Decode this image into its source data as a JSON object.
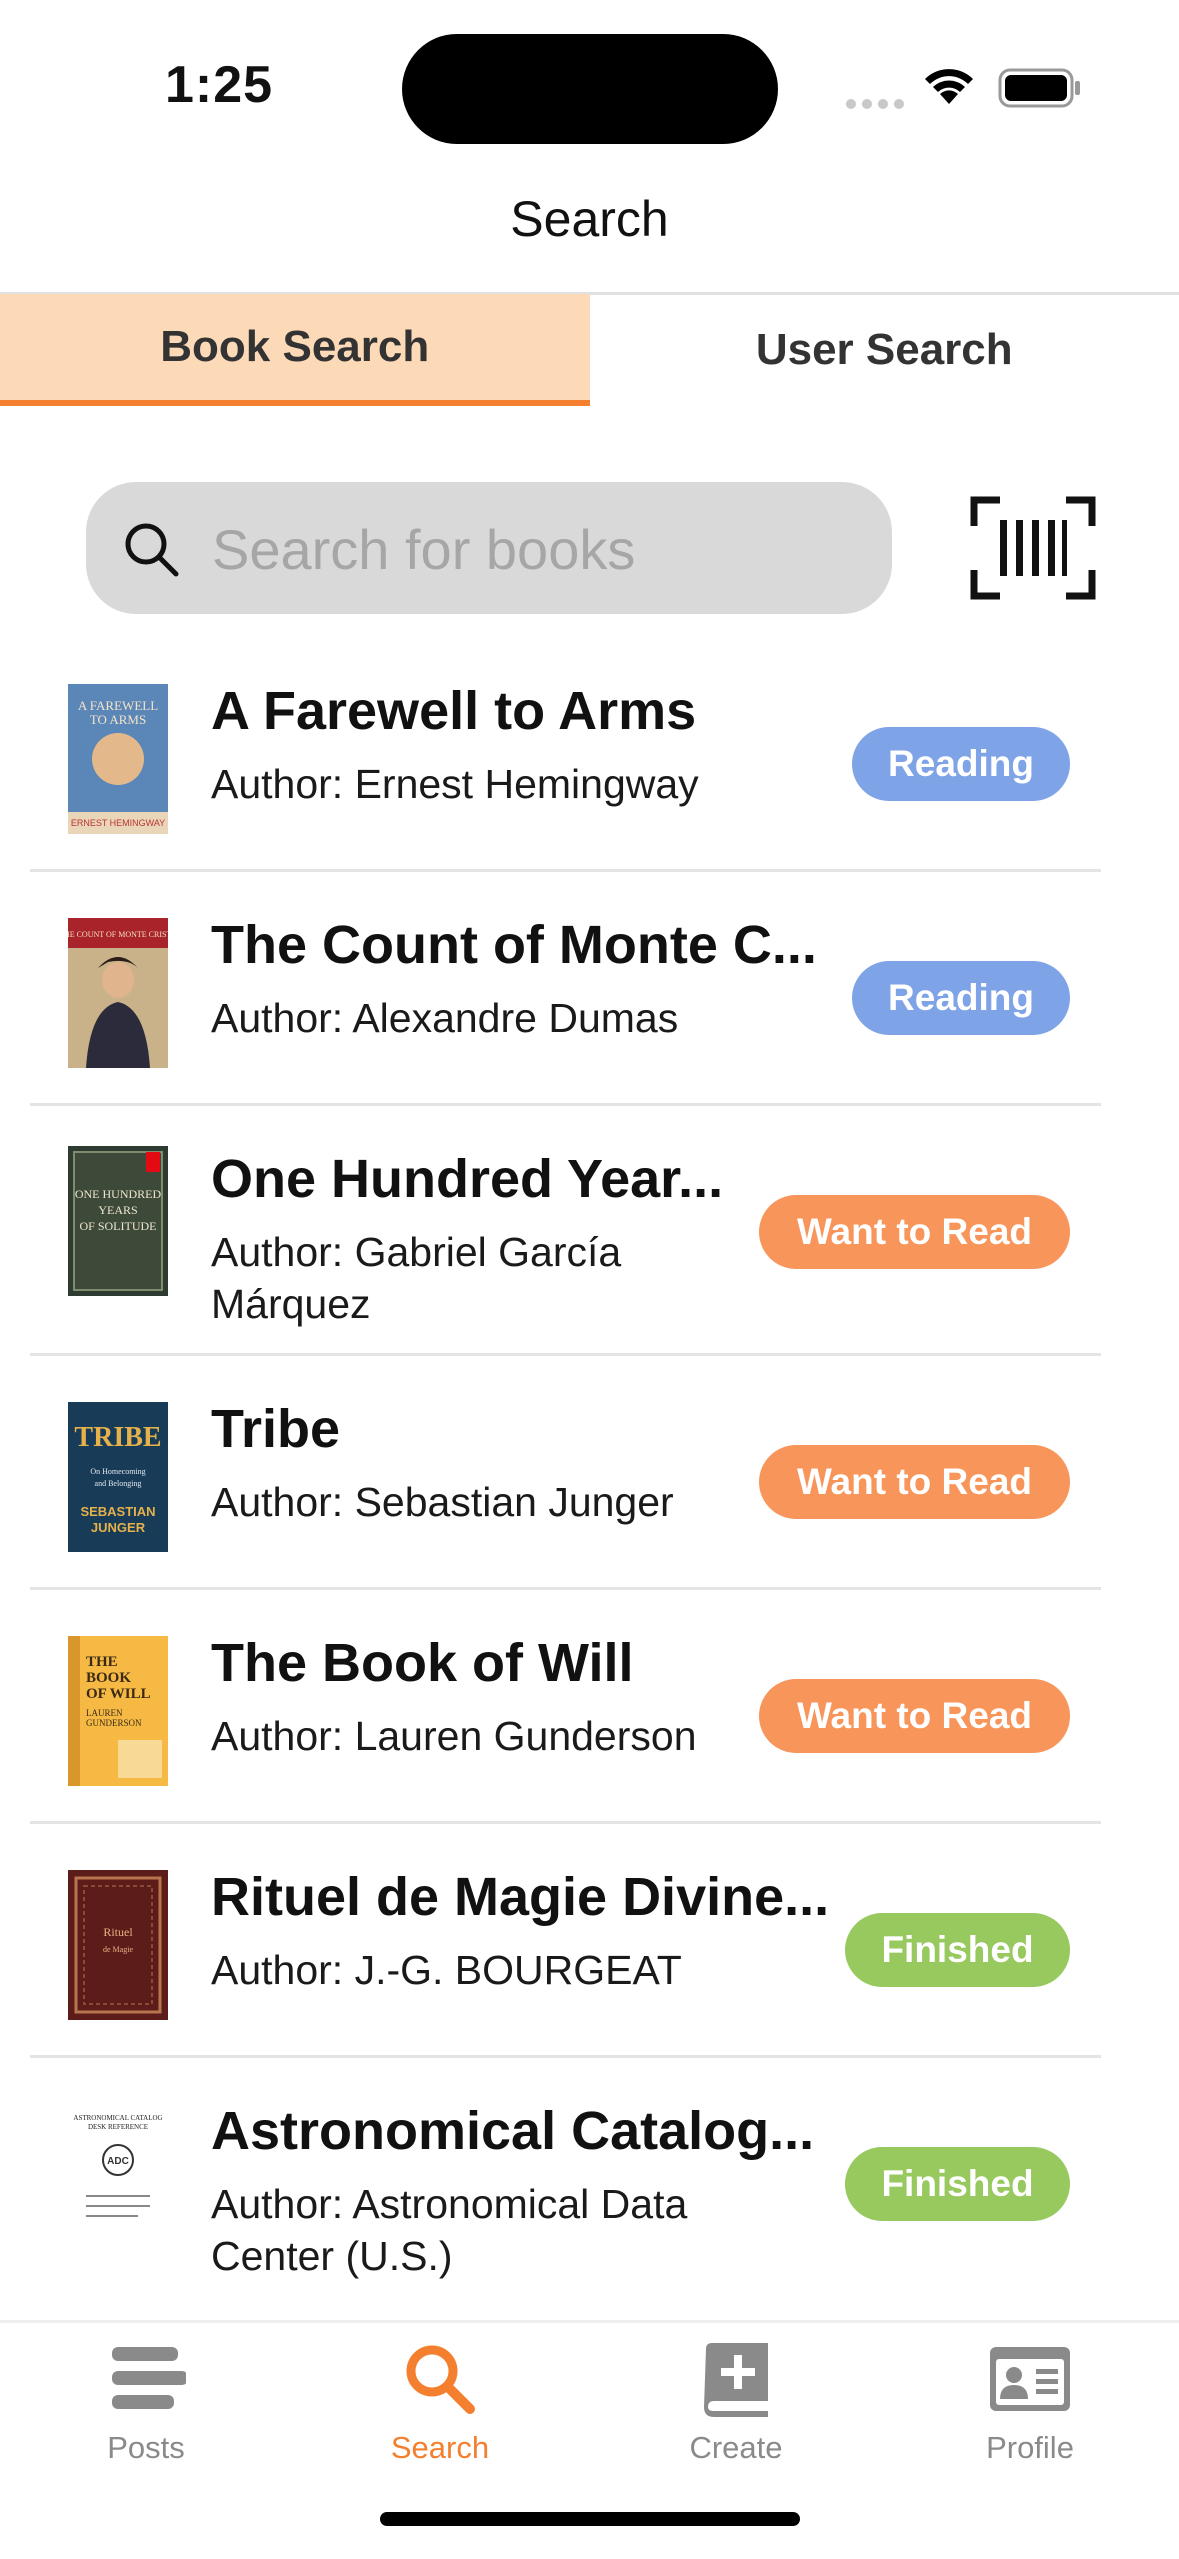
{
  "status": {
    "time": "1:25"
  },
  "header": {
    "title": "Search"
  },
  "tabs": [
    {
      "label": "Book Search",
      "active": true
    },
    {
      "label": "User Search",
      "active": false
    }
  ],
  "search": {
    "placeholder": "Search for books",
    "value": ""
  },
  "books": [
    {
      "title": "A Farewell to Arms",
      "author": "Author: Ernest Hemingway",
      "status": "Reading"
    },
    {
      "title": "The Count of Monte C...",
      "author": "Author: Alexandre Dumas",
      "status": "Reading"
    },
    {
      "title": "One Hundred Year...",
      "author": "Author: Gabriel García Márquez",
      "status": "Want to Read"
    },
    {
      "title": "Tribe",
      "author": "Author: Sebastian Junger",
      "status": "Want to Read"
    },
    {
      "title": "The Book of Will",
      "author": "Author: Lauren Gunderson",
      "status": "Want to Read"
    },
    {
      "title": "Rituel de Magie Divine...",
      "author": "Author: J.-G. BOURGEAT",
      "status": "Finished"
    },
    {
      "title": "Astronomical Catalog...",
      "author": "Author: Astronomical Data Center (U.S.)",
      "status": "Finished"
    }
  ],
  "tabbar": [
    {
      "label": "Posts",
      "icon": "posts-icon",
      "active": false
    },
    {
      "label": "Search",
      "icon": "search-icon",
      "active": true
    },
    {
      "label": "Create",
      "icon": "add-book-icon",
      "active": false
    },
    {
      "label": "Profile",
      "icon": "profile-card-icon",
      "active": false
    }
  ],
  "colors": {
    "accent": "#f4802f",
    "reading": "#7ea3e6",
    "want_to_read": "#f7955a",
    "finished": "#97c95f",
    "tab_active_bg": "#fcd9b7"
  }
}
